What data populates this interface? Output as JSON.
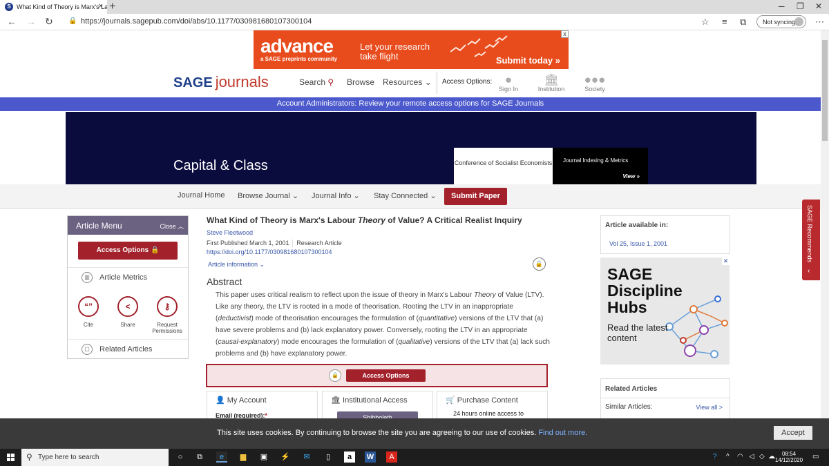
{
  "browser": {
    "tab_title": "What Kind of Theory is Marx's La",
    "tab_favicon": "S",
    "url": "https://journals.sagepub.com/doi/abs/10.1177/030981680107300104",
    "sync_label": "Not syncing"
  },
  "ad": {
    "headline": "advance",
    "subline": "a SAGE preprints community",
    "tagline": "Let your research take flight",
    "cta": "Submit today",
    "close": "x"
  },
  "header": {
    "logo_sage": "SAGE",
    "logo_journals": "journals",
    "nav": [
      "Search",
      "Browse",
      "Resources"
    ],
    "access_label": "Access Options:",
    "access_items": [
      "Sign In",
      "Institution",
      "Society"
    ]
  },
  "notice": "Account Administrators: Review your remote access options for SAGE Journals",
  "banner": {
    "journal": "Capital & Class",
    "conference": "Conference of Socialist Economists",
    "metrics_title": "Journal Indexing & Metrics",
    "metrics_view": "View »"
  },
  "subnav": {
    "items": [
      "Journal Home",
      "Browse Journal",
      "Journal Info",
      "Stay Connected"
    ],
    "submit": "Submit Paper"
  },
  "menu": {
    "title": "Article Menu",
    "close": "Close",
    "access": "Access Options",
    "metrics": "Article Metrics",
    "tools": [
      "Cite",
      "Share",
      "Request Permissions"
    ],
    "related": "Related Articles"
  },
  "article": {
    "title_pre": "What Kind of Theory is Marx's Labour ",
    "title_italic": "Theory",
    "title_post": " of Value? A Critical Realist Inquiry",
    "author": "Steve Fleetwood",
    "first_published": "First Published March 1, 2001",
    "type": "Research Article",
    "doi": "https://doi.org/10.1177/030981680107300104",
    "info_link": "Article information",
    "abstract_heading": "Abstract",
    "abstract": [
      {
        "t": "This paper uses critical realism to reflect upon the issue of theory in Marx's Labour "
      },
      {
        "t": "Theory",
        "i": true
      },
      {
        "t": " of Value (LTV). Like any theory, the LTV is rooted in a mode of theorisation. Rooting the LTV in an inappropriate ("
      },
      {
        "t": "deductivist",
        "i": true
      },
      {
        "t": ") mode of theorisation encourages the formulation of ("
      },
      {
        "t": "quantitative",
        "i": true
      },
      {
        "t": ") versions of the LTV that (a) have severe problems and (b) lack explanatory power. Conversely, rooting the LTV in an appropriate ("
      },
      {
        "t": "causal-explanatory",
        "i": true
      },
      {
        "t": ") mode encourages the formulation of ("
      },
      {
        "t": "qualitative",
        "i": true
      },
      {
        "t": ") versions of the LTV that (a) lack such problems and (b) have explanatory power."
      }
    ],
    "access_button": "Access Options",
    "panels": {
      "my_account": "My Account",
      "email_label": "Email (required):",
      "institutional": "Institutional Access",
      "shibboleth": "Shibboleth",
      "purchase": "Purchase Content",
      "purchase_note": "24 hours online access to"
    }
  },
  "right": {
    "available_title": "Article available in:",
    "available_value": "Vol 25, Issue 1, 2001",
    "hub_title": "SAGE Discipline Hubs",
    "hub_sub": "Read the latest content",
    "related_title": "Related Articles",
    "similar": "Similar Articles:",
    "view_all": "View all >",
    "recommends": "SAGE Recommends"
  },
  "cookie": {
    "message": "This site uses cookies. By continuing to browse the site you are agreeing to our use of cookies.",
    "find_out": "Find out more.",
    "accept": "Accept"
  },
  "taskbar": {
    "search": "Type here to search",
    "time": "08:54",
    "date": "14/12/2020"
  },
  "colors": {
    "brand_red": "#a2212b",
    "notice_blue": "#4b59cc",
    "banner_navy": "#0b0c3e",
    "link_blue": "#3656a8"
  }
}
